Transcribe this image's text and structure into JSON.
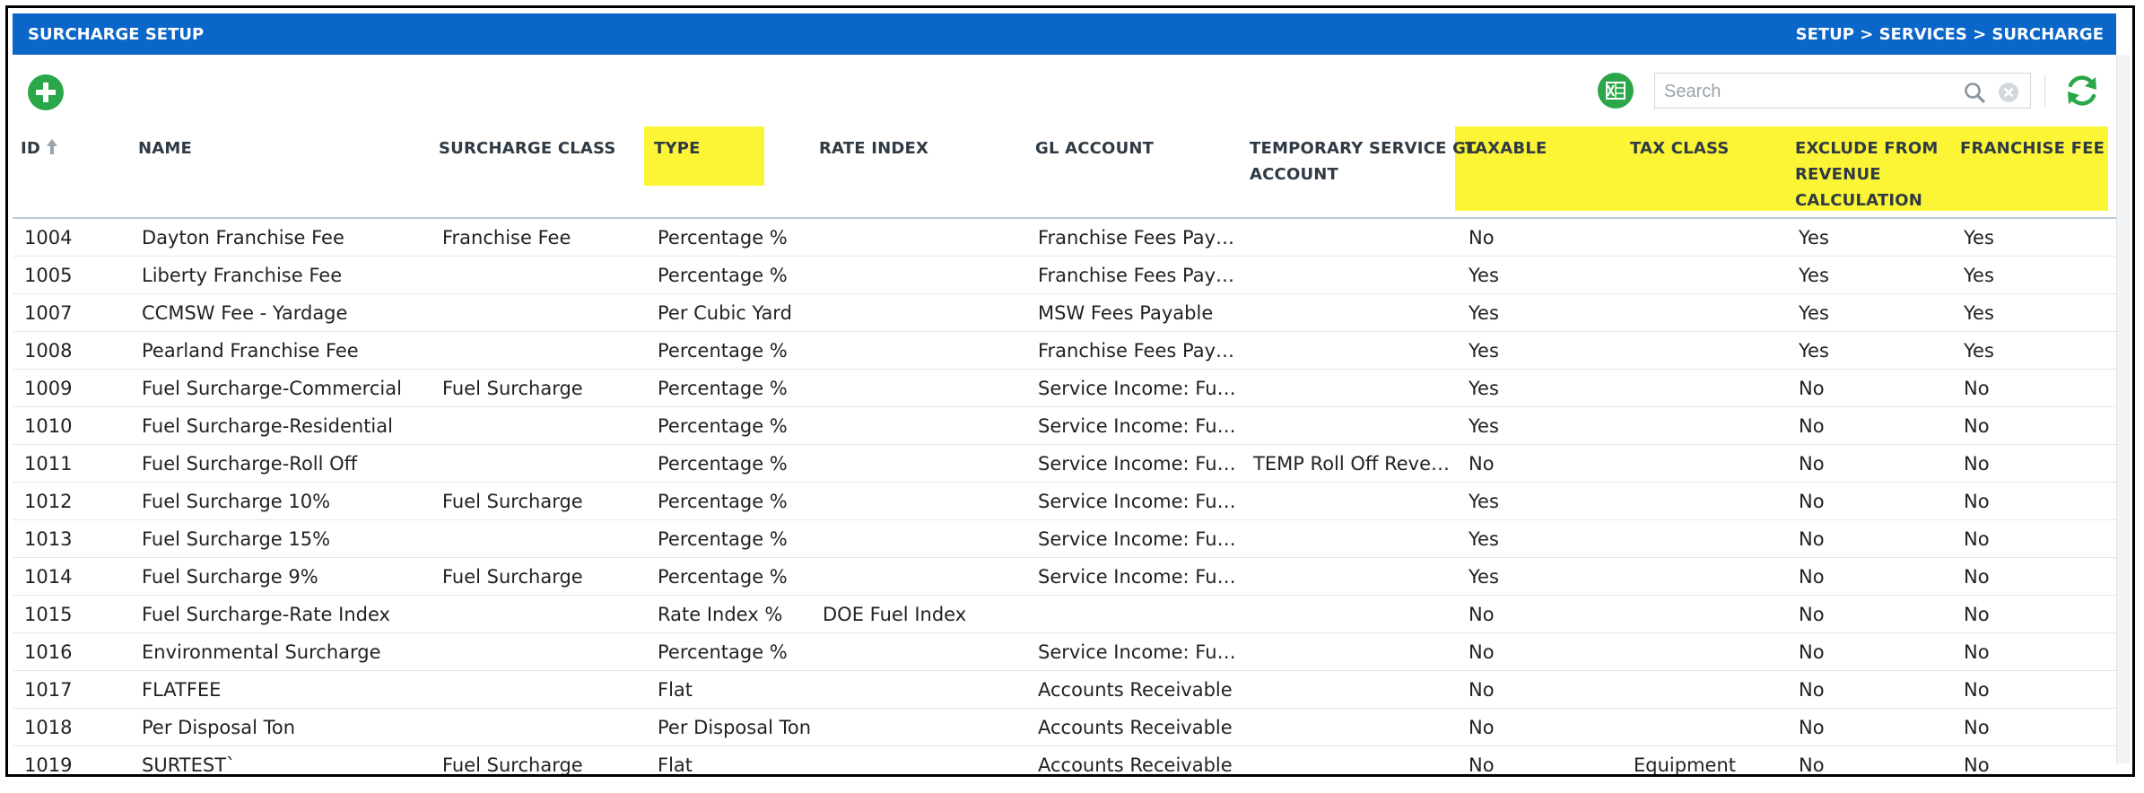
{
  "header": {
    "title": "SURCHARGE SETUP",
    "breadcrumb": "SETUP > SERVICES > SURCHARGE"
  },
  "toolbar": {
    "add_icon": "plus-circle-icon",
    "export_icon": "excel-icon",
    "search_placeholder": "Search",
    "search_value": "",
    "refresh_icon": "refresh-icon"
  },
  "colors": {
    "title_bar": "#0a66c9",
    "highlight": "#fbf535",
    "action_green": "#2aa748"
  },
  "columns": {
    "id": "ID",
    "name": "NAME",
    "surcharge_class": "SURCHARGE CLASS",
    "type": "TYPE",
    "rate_index": "RATE INDEX",
    "gl_account": "GL ACCOUNT",
    "temp_gl_1": "TEMPORARY SERVICE GL",
    "temp_gl_2": "ACCOUNT",
    "taxable": "TAXABLE",
    "tax_class": "TAX CLASS",
    "exclude_1": "EXCLUDE FROM",
    "exclude_2": "REVENUE",
    "exclude_3": "CALCULATION",
    "franchise_fee": "FRANCHISE FEE"
  },
  "rows": [
    {
      "id": "1004",
      "name": "Dayton Franchise Fee",
      "surcharge_class": "Franchise Fee",
      "type": "Percentage %",
      "rate_index": "",
      "gl_account": "Franchise Fees Payable",
      "temp_gl": "",
      "taxable": "No",
      "tax_class": "",
      "exclude": "Yes",
      "franchise_fee": "Yes"
    },
    {
      "id": "1005",
      "name": "Liberty Franchise Fee",
      "surcharge_class": "",
      "type": "Percentage %",
      "rate_index": "",
      "gl_account": "Franchise Fees Payable",
      "temp_gl": "",
      "taxable": "Yes",
      "tax_class": "",
      "exclude": "Yes",
      "franchise_fee": "Yes"
    },
    {
      "id": "1007",
      "name": "CCMSW Fee - Yardage",
      "surcharge_class": "",
      "type": "Per Cubic Yard",
      "rate_index": "",
      "gl_account": "MSW Fees Payable",
      "temp_gl": "",
      "taxable": "Yes",
      "tax_class": "",
      "exclude": "Yes",
      "franchise_fee": "Yes"
    },
    {
      "id": "1008",
      "name": "Pearland Franchise Fee",
      "surcharge_class": "",
      "type": "Percentage %",
      "rate_index": "",
      "gl_account": "Franchise Fees Payable",
      "temp_gl": "",
      "taxable": "Yes",
      "tax_class": "",
      "exclude": "Yes",
      "franchise_fee": "Yes"
    },
    {
      "id": "1009",
      "name": "Fuel Surcharge-Commercial",
      "surcharge_class": "Fuel Surcharge",
      "type": "Percentage %",
      "rate_index": "",
      "gl_account": "Service Income: Fuel …",
      "temp_gl": "",
      "taxable": "Yes",
      "tax_class": "",
      "exclude": "No",
      "franchise_fee": "No"
    },
    {
      "id": "1010",
      "name": "Fuel Surcharge-Residential",
      "surcharge_class": "",
      "type": "Percentage %",
      "rate_index": "",
      "gl_account": "Service Income: Fuel …",
      "temp_gl": "",
      "taxable": "Yes",
      "tax_class": "",
      "exclude": "No",
      "franchise_fee": "No"
    },
    {
      "id": "1011",
      "name": "Fuel Surcharge-Roll Off",
      "surcharge_class": "",
      "type": "Percentage %",
      "rate_index": "",
      "gl_account": "Service Income: Fuel …",
      "temp_gl": "TEMP Roll Off Reven…",
      "taxable": "No",
      "tax_class": "",
      "exclude": "No",
      "franchise_fee": "No"
    },
    {
      "id": "1012",
      "name": "Fuel Surcharge 10%",
      "surcharge_class": "Fuel Surcharge",
      "type": "Percentage %",
      "rate_index": "",
      "gl_account": "Service Income: Fuel …",
      "temp_gl": "",
      "taxable": "Yes",
      "tax_class": "",
      "exclude": "No",
      "franchise_fee": "No"
    },
    {
      "id": "1013",
      "name": "Fuel Surcharge 15%",
      "surcharge_class": "",
      "type": "Percentage %",
      "rate_index": "",
      "gl_account": "Service Income: Fuel …",
      "temp_gl": "",
      "taxable": "Yes",
      "tax_class": "",
      "exclude": "No",
      "franchise_fee": "No"
    },
    {
      "id": "1014",
      "name": "Fuel Surcharge 9%",
      "surcharge_class": "Fuel Surcharge",
      "type": "Percentage %",
      "rate_index": "",
      "gl_account": "Service Income: Fuel …",
      "temp_gl": "",
      "taxable": "Yes",
      "tax_class": "",
      "exclude": "No",
      "franchise_fee": "No"
    },
    {
      "id": "1015",
      "name": "Fuel Surcharge-Rate Index",
      "surcharge_class": "",
      "type": "Rate Index %",
      "rate_index": "DOE Fuel Index",
      "gl_account": "",
      "temp_gl": "",
      "taxable": "No",
      "tax_class": "",
      "exclude": "No",
      "franchise_fee": "No"
    },
    {
      "id": "1016",
      "name": "Environmental Surcharge",
      "surcharge_class": "",
      "type": "Percentage %",
      "rate_index": "",
      "gl_account": "Service Income: Fuel …",
      "temp_gl": "",
      "taxable": "No",
      "tax_class": "",
      "exclude": "No",
      "franchise_fee": "No"
    },
    {
      "id": "1017",
      "name": "FLATFEE",
      "surcharge_class": "",
      "type": "Flat",
      "rate_index": "",
      "gl_account": "Accounts Receivable",
      "temp_gl": "",
      "taxable": "No",
      "tax_class": "",
      "exclude": "No",
      "franchise_fee": "No"
    },
    {
      "id": "1018",
      "name": "Per Disposal Ton",
      "surcharge_class": "",
      "type": "Per Disposal Ton",
      "rate_index": "",
      "gl_account": "Accounts Receivable",
      "temp_gl": "",
      "taxable": "No",
      "tax_class": "",
      "exclude": "No",
      "franchise_fee": "No"
    },
    {
      "id": "1019",
      "name": "SURTEST`",
      "surcharge_class": "Fuel Surcharge",
      "type": "Flat",
      "rate_index": "",
      "gl_account": "Accounts Receivable",
      "temp_gl": "",
      "taxable": "No",
      "tax_class": "Equipment",
      "exclude": "No",
      "franchise_fee": "No"
    }
  ]
}
